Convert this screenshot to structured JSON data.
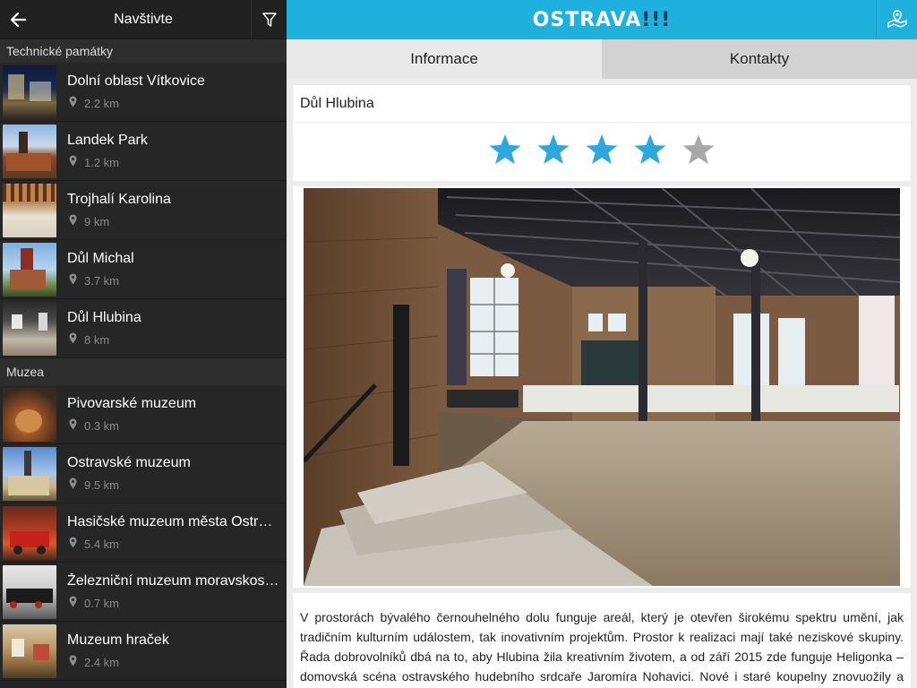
{
  "sidebar": {
    "title": "Navštivte",
    "sections": [
      {
        "label": "Technické památky",
        "items": [
          {
            "name": "Dolní oblast Vítkovice",
            "distance": "2.2 km"
          },
          {
            "name": "Landek Park",
            "distance": "1.2 km"
          },
          {
            "name": "Trojhalí Karolina",
            "distance": "9 km"
          },
          {
            "name": "Důl Michal",
            "distance": "3.7 km"
          },
          {
            "name": "Důl Hlubina",
            "distance": "8 km"
          }
        ]
      },
      {
        "label": "Muzea",
        "items": [
          {
            "name": "Pivovarské muzeum",
            "distance": "0.3 km"
          },
          {
            "name": "Ostravské muzeum",
            "distance": "9.5 km"
          },
          {
            "name": "Hasičské muzeum města Ostravy",
            "distance": "5.4 km"
          },
          {
            "name": "Železniční muzeum moravskoslezské",
            "distance": "0.7 km"
          },
          {
            "name": "Muzeum hraček",
            "distance": "2.4 km"
          }
        ]
      }
    ]
  },
  "header": {
    "logo": "OSTRAVA",
    "logo_suffix": "!!!",
    "accent_color": "#1fb1dd"
  },
  "tabs": [
    {
      "label": "Informace",
      "active": true
    },
    {
      "label": "Kontakty",
      "active": false
    }
  ],
  "detail": {
    "title": "Důl Hlubina",
    "rating": 4,
    "max_rating": 5,
    "description": "V prostorách bývalého černouhelného dolu funguje areál, který je otevřen širokému spektru umění, jak tradičním kulturním událostem, tak inovativním projektům. Prostor k realizaci mají také neziskové skupiny. Řada dobrovolníků dbá na to, aby Hlubina žila kreativním životem, a od září 2015 zde funguje Heligonka – domovská scéna ostravského hudebního srdcaře Jaromíra Nohavici. Nové i staré koupelny znovuožily a nyní slouží k zajímavým setkáním. Colours of Ostrava, mezinárodní filmový festival OKO, tvůrčí setkání"
  },
  "icons": {
    "back": "arrow-left-icon",
    "filter": "filter-icon",
    "map": "map-icon",
    "pin": "location-pin-icon",
    "star": "star-icon"
  }
}
